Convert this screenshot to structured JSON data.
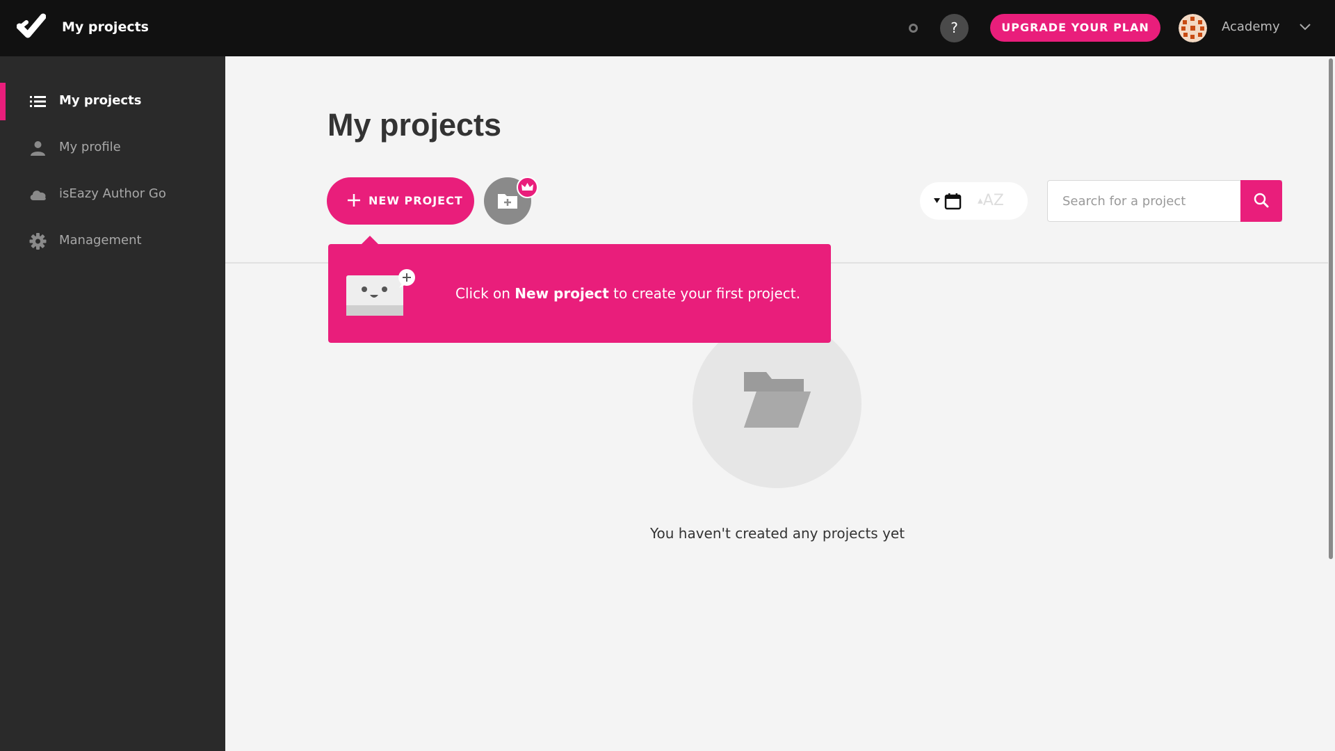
{
  "topbar": {
    "title": "My projects",
    "help_label": "?",
    "upgrade_label": "UPGRADE YOUR PLAN",
    "account_name": "Academy"
  },
  "sidebar": {
    "items": [
      {
        "label": "My projects",
        "icon": "list-icon",
        "active": true
      },
      {
        "label": "My profile",
        "icon": "person-icon",
        "active": false
      },
      {
        "label": "isEazy Author Go",
        "icon": "cloud-icon",
        "active": false
      },
      {
        "label": "Management",
        "icon": "gear-icon",
        "active": false
      }
    ]
  },
  "main": {
    "page_title": "My projects",
    "new_project_label": "NEW PROJECT",
    "sort_az_label": "AZ",
    "search_placeholder": "Search for a project",
    "empty_message": "You haven't created any projects yet"
  },
  "tooltip": {
    "text_before": "Click on ",
    "text_bold": "New project",
    "text_after": " to create your first project."
  },
  "colors": {
    "accent": "#e91e7b",
    "topbar_bg": "#111111",
    "sidebar_bg": "#2a2a2a",
    "main_bg": "#f4f4f4"
  }
}
